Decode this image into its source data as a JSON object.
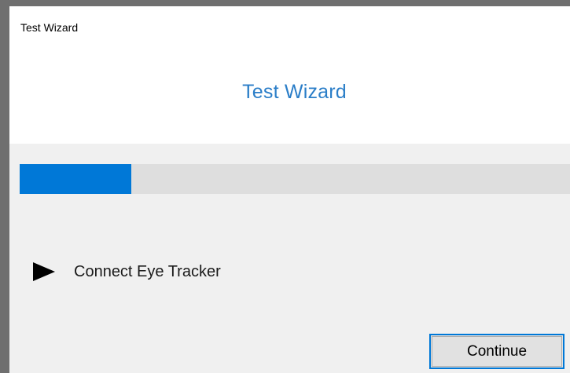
{
  "window": {
    "title": "Test Wizard"
  },
  "header": {
    "title": "Test Wizard",
    "title_color": "#2b7ec8"
  },
  "progress": {
    "fraction": 0.2,
    "fill_color": "#0078d7",
    "track_color": "#dedede"
  },
  "step": {
    "icon": "play-icon",
    "label": "Connect Eye Tracker"
  },
  "actions": {
    "continue_label": "Continue",
    "continue_border_color": "#0078d7"
  }
}
